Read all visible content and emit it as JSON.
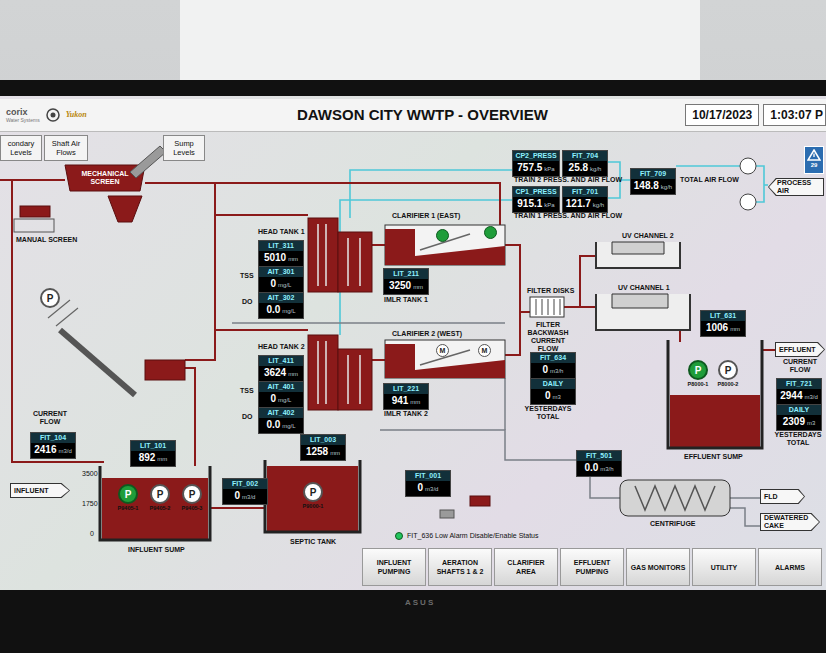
{
  "brand": {
    "logo": "corix",
    "tagline": "Water Systems",
    "partner": "Yukon"
  },
  "header": {
    "title": "DAWSON CITY WWTP - OVERVIEW",
    "date": "10/17/2023",
    "time": "1:03:07 P"
  },
  "top_buttons": [
    {
      "label": "condary Levels"
    },
    {
      "label": "Shaft Air Flows"
    },
    {
      "label": "Sump Levels"
    }
  ],
  "alarm_badge": {
    "count": "29"
  },
  "labels": [
    {
      "text": "MECHANICAL SCREEN",
      "kind": "onred"
    },
    {
      "text": "MANUAL SCREEN",
      "kind": "caption"
    },
    {
      "text": "HEAD TANK 1",
      "kind": "caption"
    },
    {
      "text": "TSS",
      "kind": "caption"
    },
    {
      "text": "DO",
      "kind": "caption"
    },
    {
      "text": "IMLR TANK 1",
      "kind": "caption"
    },
    {
      "text": "HEAD TANK 2",
      "kind": "caption"
    },
    {
      "text": "TSS",
      "kind": "caption"
    },
    {
      "text": "DO",
      "kind": "caption"
    },
    {
      "text": "IMLR TANK 2",
      "kind": "caption"
    },
    {
      "text": "TRAIN 2 PRESS. AND AIR FLOW",
      "kind": "caption"
    },
    {
      "text": "TRAIN 1 PRESS. AND AIR FLOW",
      "kind": "caption"
    },
    {
      "text": "TOTAL AIR FLOW",
      "kind": "caption"
    },
    {
      "text": "UV CHANNEL 2",
      "kind": "caption"
    },
    {
      "text": "UV CHANNEL 1",
      "kind": "caption"
    },
    {
      "text": "FILTER DISKS",
      "kind": "caption"
    },
    {
      "text": "FILTER BACKWASH CURRENT FLOW",
      "kind": "caption"
    },
    {
      "text": "YESTERDAYS TOTAL",
      "kind": "caption"
    },
    {
      "text": "EFFLUENT SUMP",
      "kind": "caption"
    },
    {
      "text": "CURRENT FLOW",
      "kind": "caption"
    },
    {
      "text": "YESTERDAYS TOTAL",
      "kind": "caption"
    },
    {
      "text": "CURRENT FLOW",
      "kind": "caption"
    },
    {
      "text": "INFLUENT SUMP",
      "kind": "caption"
    },
    {
      "text": "SEPTIC TANK",
      "kind": "caption"
    },
    {
      "text": "CENTRIFUGE",
      "kind": "caption"
    },
    {
      "text": "3500",
      "kind": "scale"
    },
    {
      "text": "1750",
      "kind": "scale"
    },
    {
      "text": "0",
      "kind": "scale"
    }
  ],
  "clarifiers": [
    {
      "title": "CLARIFIER 1 (EAST)",
      "drives": [
        {
          "symbol": "",
          "running": true
        },
        {
          "symbol": "",
          "running": true
        }
      ]
    },
    {
      "title": "CLARIFIER 2 (WEST)",
      "drives": [
        {
          "symbol": "M",
          "running": false
        },
        {
          "symbol": "M",
          "running": false
        }
      ]
    }
  ],
  "instruments": [
    {
      "tag": "LIT_311",
      "value": "5010",
      "unit": "mm"
    },
    {
      "tag": "AIT_301",
      "value": "0",
      "unit": "mg/L"
    },
    {
      "tag": "AIT_302",
      "value": "0.0",
      "unit": "mg/L"
    },
    {
      "tag": "LIT_211",
      "value": "3250",
      "unit": "mm"
    },
    {
      "tag": "LIT_411",
      "value": "3624",
      "unit": "mm"
    },
    {
      "tag": "AIT_401",
      "value": "0",
      "unit": "mg/L"
    },
    {
      "tag": "AIT_402",
      "value": "0.0",
      "unit": "mg/L"
    },
    {
      "tag": "LIT_221",
      "value": "941",
      "unit": "mm"
    },
    {
      "tag": "CP2_PRESS",
      "value": "757.5",
      "unit": "kPa"
    },
    {
      "tag": "FIT_704",
      "value": "25.8",
      "unit": "kg/h"
    },
    {
      "tag": "CP1_PRESS",
      "value": "915.1",
      "unit": "kPa"
    },
    {
      "tag": "FIT_701",
      "value": "121.7",
      "unit": "kg/h"
    },
    {
      "tag": "FIT_709",
      "value": "148.8",
      "unit": "kg/h"
    },
    {
      "tag": "LIT_631",
      "value": "1006",
      "unit": "mm"
    },
    {
      "tag": "FIT_634",
      "value": "0",
      "unit": "m3/h"
    },
    {
      "tag": "DAILY",
      "value": "0",
      "unit": "m3"
    },
    {
      "tag": "FIT_721",
      "value": "2944",
      "unit": "m3/d"
    },
    {
      "tag": "DAILY",
      "value": "2309",
      "unit": "m3"
    },
    {
      "tag": "FIT_104",
      "value": "2416",
      "unit": "m3/d"
    },
    {
      "tag": "LIT_101",
      "value": "892",
      "unit": "mm"
    },
    {
      "tag": "FIT_002",
      "value": "0",
      "unit": "m3/d"
    },
    {
      "tag": "LIT_003",
      "value": "1258",
      "unit": "mm"
    },
    {
      "tag": "FIT_001",
      "value": "0",
      "unit": "m3/d"
    },
    {
      "tag": "FIT_501",
      "value": "0.0",
      "unit": "m3/h"
    }
  ],
  "pumps": [
    {
      "symbol": "P",
      "label": "P9405-1",
      "running": true
    },
    {
      "symbol": "P",
      "label": "P9405-2",
      "running": false
    },
    {
      "symbol": "P",
      "label": "P9405-3",
      "running": false
    },
    {
      "symbol": "P",
      "label": "P9000-1",
      "running": false
    },
    {
      "symbol": "P",
      "label": "P8000-1",
      "running": true
    },
    {
      "symbol": "P",
      "label": "P8000-2",
      "running": false
    }
  ],
  "feed_pump": {
    "symbol": "P",
    "running": false
  },
  "arrows": [
    {
      "text": "INFLUENT",
      "kind": "right"
    },
    {
      "text": "PROCESS AIR",
      "kind": "left"
    },
    {
      "text": "EFFLUENT",
      "kind": "right"
    },
    {
      "text": "FLD",
      "kind": "right"
    },
    {
      "text": "DEWATERED CAKE",
      "kind": "right"
    }
  ],
  "legend": {
    "text": "FIT_636 Low Alarm Disable/Enable Status",
    "active": true
  },
  "nav": [
    {
      "label": "INFLUENT PUMPING",
      "selected": false
    },
    {
      "label": "AERATION SHAFTS 1 & 2",
      "selected": false
    },
    {
      "label": "CLARIFIER AREA",
      "selected": false
    },
    {
      "label": "EFFLUENT PUMPING",
      "selected": false
    },
    {
      "label": "GAS MONITORS",
      "selected": false
    },
    {
      "label": "UTILITY",
      "selected": false
    },
    {
      "label": "ALARMS",
      "selected": false
    }
  ],
  "monitor_brand": "ASUS"
}
